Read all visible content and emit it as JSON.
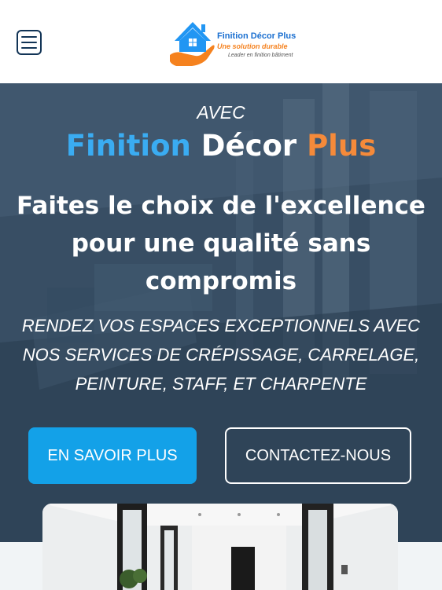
{
  "header": {
    "menu_icon": "hamburger-menu-icon",
    "logo": {
      "name": "Finition Décor Plus",
      "tagline": "Une solution durable",
      "subtitle": "Leader en finition bâtiment",
      "icon": "house-hand-logo-icon"
    }
  },
  "hero": {
    "kicker": "AVEC",
    "brand": {
      "word1": "Finition",
      "word2": "Décor",
      "word3": "Plus"
    },
    "headline": "Faites le choix de l'excellence pour une qualité sans compromis",
    "subline": "Rendez vos espaces exceptionnels avec nos services de crépissage, carrelage, peinture, staff, et charpente",
    "buttons": {
      "primary": "EN SAVOIR PLUS",
      "secondary": "CONTACTEZ-NOUS"
    }
  },
  "colors": {
    "accent_blue": "#13a1e8",
    "brand_blue": "#3aacf2",
    "brand_orange": "#f58a3a",
    "header_icon": "#123456"
  }
}
